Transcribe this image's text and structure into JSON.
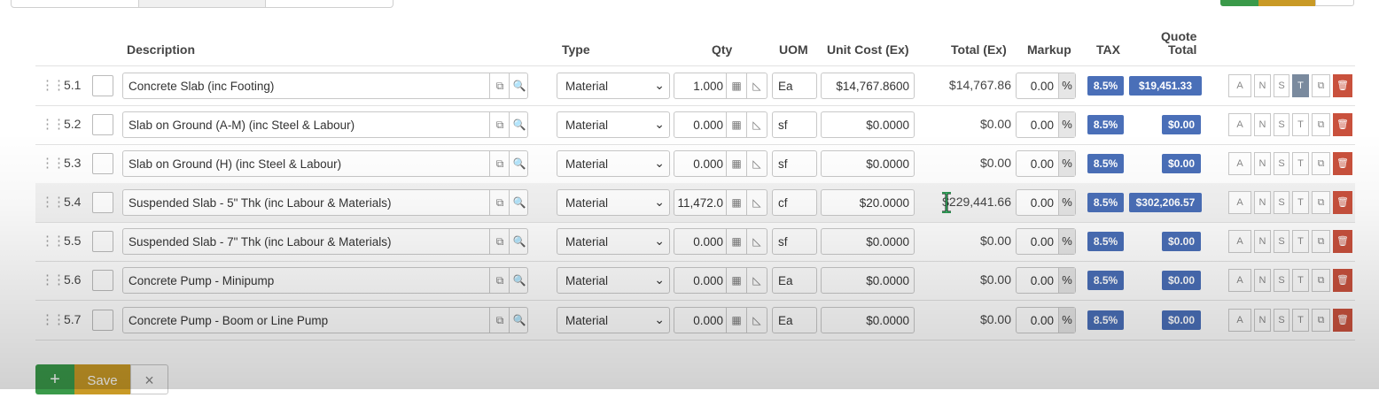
{
  "headers": {
    "description": "Description",
    "type": "Type",
    "qty": "Qty",
    "uom": "UOM",
    "unit_cost": "Unit Cost (Ex)",
    "total": "Total (Ex)",
    "markup": "Markup",
    "tax": "TAX",
    "quote_total_line1": "Quote",
    "quote_total_line2": "Total"
  },
  "rows": [
    {
      "num": "5.1",
      "description": "Concrete Slab (inc Footing)",
      "type": "Material",
      "qty": "1.000",
      "uom": "Ea",
      "unit_cost": "$14,767.8600",
      "total": "$14,767.86",
      "markup": "0.00",
      "tax": "8.5%",
      "quote_total": "$19,451.33"
    },
    {
      "num": "5.2",
      "description": "Slab on Ground (A-M) (inc Steel & Labour)",
      "type": "Material",
      "qty": "0.000",
      "uom": "sf",
      "unit_cost": "$0.0000",
      "total": "$0.00",
      "markup": "0.00",
      "tax": "8.5%",
      "quote_total": "$0.00"
    },
    {
      "num": "5.3",
      "description": "Slab on Ground (H) (inc Steel & Labour)",
      "type": "Material",
      "qty": "0.000",
      "uom": "sf",
      "unit_cost": "$0.0000",
      "total": "$0.00",
      "markup": "0.00",
      "tax": "8.5%",
      "quote_total": "$0.00"
    },
    {
      "num": "5.4",
      "description": "Suspended Slab - 5\" Thk (inc Labour & Materials)",
      "type": "Material",
      "qty": "11,472.0",
      "uom": "cf",
      "unit_cost": "$20.0000",
      "total": "$229,441.66",
      "markup": "0.00",
      "tax": "8.5%",
      "quote_total": "$302,206.57"
    },
    {
      "num": "5.5",
      "description": "Suspended Slab - 7\" Thk (inc Labour & Materials)",
      "type": "Material",
      "qty": "0.000",
      "uom": "sf",
      "unit_cost": "$0.0000",
      "total": "$0.00",
      "markup": "0.00",
      "tax": "8.5%",
      "quote_total": "$0.00"
    },
    {
      "num": "5.6",
      "description": "Concrete Pump - Minipump",
      "type": "Material",
      "qty": "0.000",
      "uom": "Ea",
      "unit_cost": "$0.0000",
      "total": "$0.00",
      "markup": "0.00",
      "tax": "8.5%",
      "quote_total": "$0.00"
    },
    {
      "num": "5.7",
      "description": "Concrete Pump - Boom or Line Pump",
      "type": "Material",
      "qty": "0.000",
      "uom": "Ea",
      "unit_cost": "$0.0000",
      "total": "$0.00",
      "markup": "0.00",
      "tax": "8.5%",
      "quote_total": "$0.00"
    }
  ],
  "symbols": {
    "percent": "%",
    "drag_handle": "⋮⋮",
    "copy_icon": "⧉",
    "search_icon": "🔍",
    "calculator_icon": "▦",
    "ruler_icon": "◺",
    "caret_icon": "⌄",
    "trash_icon": "🗑"
  },
  "row_actions": [
    {
      "label": "A",
      "name": "a"
    },
    {
      "label": "N",
      "name": "n"
    },
    {
      "label": "S",
      "name": "s"
    },
    {
      "label": "T",
      "name": "t"
    }
  ],
  "active_action_row": "5.1",
  "footer": {
    "add_label": "+",
    "save_label": "Save",
    "cancel_label": "×"
  },
  "colors": {
    "badge_blue": "#4a6fb8",
    "save_gold": "#c99a26",
    "add_green": "#3a9a4a",
    "delete_red": "#c9513d"
  }
}
